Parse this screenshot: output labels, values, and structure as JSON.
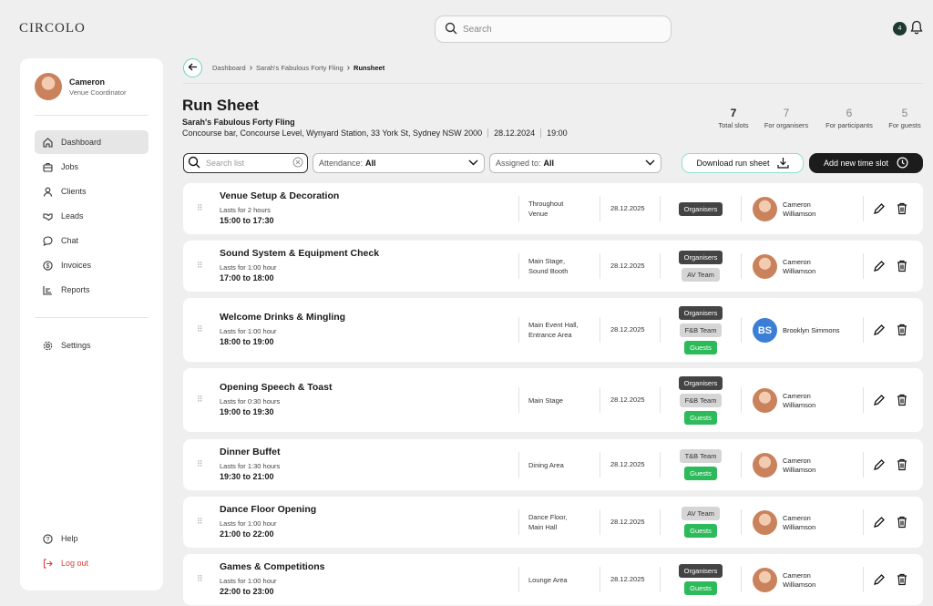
{
  "app": {
    "logo": "CIRCOLO"
  },
  "topbar": {
    "search_placeholder": "Search",
    "notification_count": "4"
  },
  "sidebar": {
    "user": {
      "name": "Cameron",
      "role": "Venue Coordinator"
    },
    "items": [
      {
        "label": "Dashboard",
        "icon": "home-icon",
        "active": true
      },
      {
        "label": "Jobs",
        "icon": "briefcase-icon"
      },
      {
        "label": "Clients",
        "icon": "user-icon"
      },
      {
        "label": "Leads",
        "icon": "handshake-icon"
      },
      {
        "label": "Chat",
        "icon": "chat-icon"
      },
      {
        "label": "Invoices",
        "icon": "dollar-icon"
      },
      {
        "label": "Reports",
        "icon": "chart-icon"
      }
    ],
    "settings": "Settings",
    "help": "Help",
    "logout": "Log out"
  },
  "breadcrumb": {
    "items": [
      "Dashboard",
      "Sarah's Fabulous Forty Fling"
    ],
    "current": "Runsheet"
  },
  "header": {
    "title": "Run Sheet",
    "event_name": "Sarah's Fabulous Forty Fling",
    "location": "Concourse bar, Concourse Level, Wynyard Station, 33 York St, Sydney NSW 2000",
    "date": "28.12.2024",
    "time": "19:00"
  },
  "stats": [
    {
      "value": "7",
      "label": "Total slots"
    },
    {
      "value": "7",
      "label": "For organisers"
    },
    {
      "value": "6",
      "label": "For participants"
    },
    {
      "value": "5",
      "label": "For guests"
    }
  ],
  "filters": {
    "search_placeholder": "Search list",
    "attendance_label": "Attendance:",
    "attendance_value": "All",
    "assigned_label": "Assigned to:",
    "assigned_value": "All"
  },
  "actions": {
    "download": "Download run sheet",
    "add": "Add new time slot"
  },
  "slots": [
    {
      "title": "Venue Setup & Decoration",
      "duration": "Lasts for 2 hours",
      "time": "15:00 to 17:30",
      "location": [
        "Throughout",
        "Venue"
      ],
      "date": "28.12.2025",
      "tags": [
        {
          "label": "Organisers",
          "style": "dark"
        }
      ],
      "assignee": [
        "Cameron",
        "Williamson"
      ]
    },
    {
      "title": "Sound System & Equipment Check",
      "duration": "Lasts for 1:00 hour",
      "time": "17:00 to 18:00",
      "location": [
        "Main Stage,",
        "Sound Booth"
      ],
      "date": "28.12.2025",
      "tags": [
        {
          "label": "Organisers",
          "style": "dark"
        },
        {
          "label": "AV Team",
          "style": "grey"
        }
      ],
      "assignee": [
        "Cameron",
        "Williamson"
      ]
    },
    {
      "title": "Welcome Drinks & Mingling",
      "duration": "Lasts for 1:00 hour",
      "time": "18:00 to 19:00",
      "location": [
        "Main Event Hall,",
        "Entrance Area"
      ],
      "date": "28.12.2025",
      "tags": [
        {
          "label": "Organisers",
          "style": "dark"
        },
        {
          "label": "F&B Team",
          "style": "grey"
        },
        {
          "label": "Guests",
          "style": "green"
        }
      ],
      "assignee": [
        "Brooklyn Simmons"
      ],
      "initials": "BS"
    },
    {
      "title": "Opening Speech & Toast",
      "duration": "Lasts for 0:30 hours",
      "time": "19:00 to 19:30",
      "location": [
        "Main Stage"
      ],
      "date": "28.12.2025",
      "tags": [
        {
          "label": "Organisers",
          "style": "dark"
        },
        {
          "label": "F&B Team",
          "style": "grey"
        },
        {
          "label": "Guests",
          "style": "green"
        }
      ],
      "assignee": [
        "Cameron",
        "Williamson"
      ]
    },
    {
      "title": "Dinner Buffet",
      "duration": "Lasts for 1:30 hours",
      "time": "19:30 to 21:00",
      "location": [
        "Dining Area"
      ],
      "date": "28.12.2025",
      "tags": [
        {
          "label": "T&B Team",
          "style": "grey"
        },
        {
          "label": "Guests",
          "style": "green"
        }
      ],
      "assignee": [
        "Cameron",
        "Williamson"
      ]
    },
    {
      "title": "Dance Floor Opening",
      "duration": "Lasts for 1:00 hour",
      "time": "21:00 to 22:00",
      "location": [
        "Dance Floor,",
        "Main Hall"
      ],
      "date": "28.12.2025",
      "tags": [
        {
          "label": "AV Team",
          "style": "grey"
        },
        {
          "label": "Guests",
          "style": "green"
        }
      ],
      "assignee": [
        "Cameron",
        "Williamson"
      ]
    },
    {
      "title": "Games & Competitions",
      "duration": "Lasts for 1:00 hour",
      "time": "22:00 to 23:00",
      "location": [
        "Lounge Area"
      ],
      "date": "28.12.2025",
      "tags": [
        {
          "label": "Organisers",
          "style": "dark"
        },
        {
          "label": "Guests",
          "style": "green"
        }
      ],
      "assignee": [
        "Cameron",
        "Williamson"
      ]
    }
  ]
}
